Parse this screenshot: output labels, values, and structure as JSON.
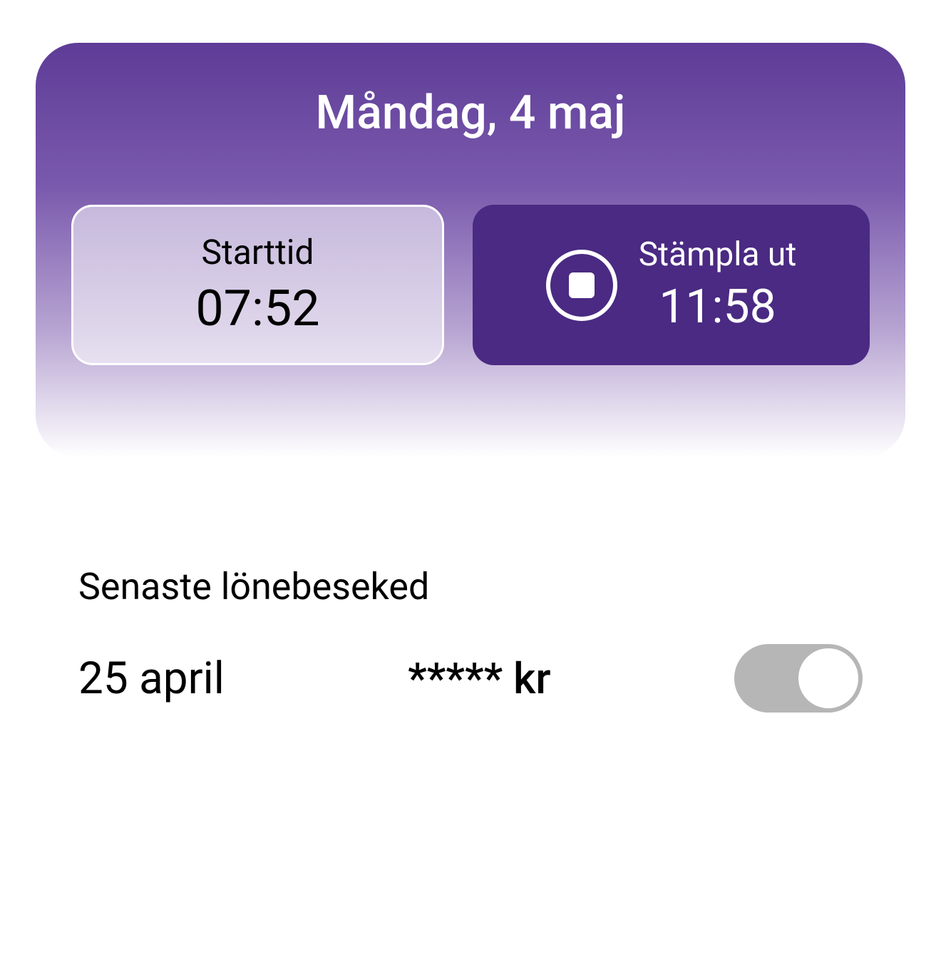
{
  "card": {
    "date_title": "Måndag, 4 maj",
    "start": {
      "label": "Starttid",
      "time": "07:52"
    },
    "punch_out": {
      "label": "Stämpla ut",
      "time": "11:58"
    }
  },
  "payslip": {
    "heading": "Senaste lönebeseked",
    "date": "25 april",
    "amount_masked": "***** kr"
  }
}
